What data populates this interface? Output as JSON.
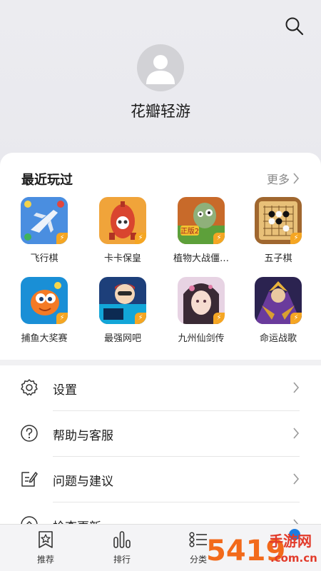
{
  "profile": {
    "username": "花瓣轻游"
  },
  "recent": {
    "title": "最近玩过",
    "more_label": "更多",
    "games": [
      {
        "label": "飞行棋",
        "icon": "airplane-chess-icon"
      },
      {
        "label": "卡卡保皇",
        "icon": "card-game-icon"
      },
      {
        "label": "植物大战僵…",
        "icon": "zombie-icon"
      },
      {
        "label": "五子棋",
        "icon": "gomoku-board-icon"
      },
      {
        "label": "捕鱼大奖赛",
        "icon": "fish-icon"
      },
      {
        "label": "最强网吧",
        "icon": "gamer-icon"
      },
      {
        "label": "九州仙剑传",
        "icon": "fairy-girl-icon"
      },
      {
        "label": "命运战歌",
        "icon": "warrior-icon"
      }
    ],
    "badge_color": "#f5a623"
  },
  "menu": {
    "items": [
      {
        "label": "设置",
        "icon": "gear-icon"
      },
      {
        "label": "帮助与客服",
        "icon": "help-icon"
      },
      {
        "label": "问题与建议",
        "icon": "feedback-icon"
      },
      {
        "label": "检查更新",
        "icon": "update-icon"
      }
    ]
  },
  "tabs": [
    {
      "label": "推荐",
      "icon": "star-badge-icon"
    },
    {
      "label": "排行",
      "icon": "bar-rank-icon"
    },
    {
      "label": "分类",
      "icon": "category-list-icon"
    }
  ],
  "watermark": {
    "text": "手游网",
    "domain": ".com.cn",
    "number": "5419"
  }
}
